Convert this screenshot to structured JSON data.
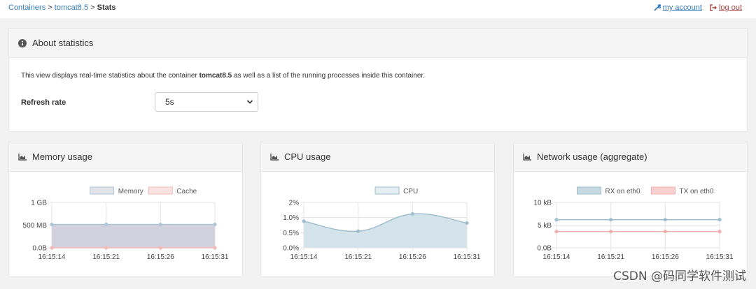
{
  "breadcrumb": {
    "containers": "Containers",
    "sep": ">",
    "container": "tomcat8.5",
    "current": "Stats"
  },
  "account": {
    "my_account": "my account",
    "log_out": "log out"
  },
  "about": {
    "title": "About statistics",
    "desc_pre": "This view displays real-time statistics about the container",
    "desc_container": "tomcat8.5",
    "desc_post": "as well as a list of the running processes inside this container.",
    "refresh_label": "Refresh rate",
    "refresh_value": "5s"
  },
  "charts": {
    "memory_title": "Memory usage",
    "cpu_title": "CPU usage",
    "network_title": "Network usage (aggregate)"
  },
  "chart_data": [
    {
      "type": "area",
      "id": "memory",
      "x": [
        "16:15:14",
        "16:15:21",
        "16:15:26",
        "16:15:31"
      ],
      "yticks": [
        "1 GB",
        "500 MB",
        "0.0B"
      ],
      "ylim": [
        0,
        1000
      ],
      "series": [
        {
          "name": "Memory",
          "values": [
            515,
            515,
            515,
            515
          ],
          "color": "#aec6d7",
          "fill": "#d0d0dc"
        },
        {
          "name": "Cache",
          "values": [
            0,
            0,
            0,
            0
          ],
          "color": "#f3b8b8",
          "fill": "#f6d0d0"
        }
      ],
      "grid": true,
      "legend": "top"
    },
    {
      "type": "area",
      "id": "cpu",
      "x": [
        "16:15:14",
        "16:15:21",
        "16:15:26",
        "16:15:31"
      ],
      "yticks": [
        "2%",
        "1.0%",
        "0.5%",
        "0.0%"
      ],
      "ylim": [
        0,
        1.5
      ],
      "series": [
        {
          "name": "CPU",
          "values": [
            0.88,
            0.55,
            1.12,
            0.82
          ],
          "color": "#9fbfcf",
          "fill": "#d3e3ea"
        }
      ],
      "grid": true,
      "legend": "top"
    },
    {
      "type": "line",
      "id": "network",
      "x": [
        "16:15:14",
        "16:15:21",
        "16:15:26",
        "16:15:31"
      ],
      "yticks": [
        "10 kB",
        "5 kB",
        "0.0B"
      ],
      "ylim": [
        0,
        10
      ],
      "series": [
        {
          "name": "RX on eth0",
          "values": [
            6.2,
            6.2,
            6.2,
            6.2
          ],
          "color": "#9fbfcf"
        },
        {
          "name": "TX on eth0",
          "values": [
            3.6,
            3.6,
            3.6,
            3.6
          ],
          "color": "#f3b0b0"
        }
      ],
      "grid": true,
      "legend": "top"
    }
  ],
  "watermark": "CSDN @码同学软件测试"
}
